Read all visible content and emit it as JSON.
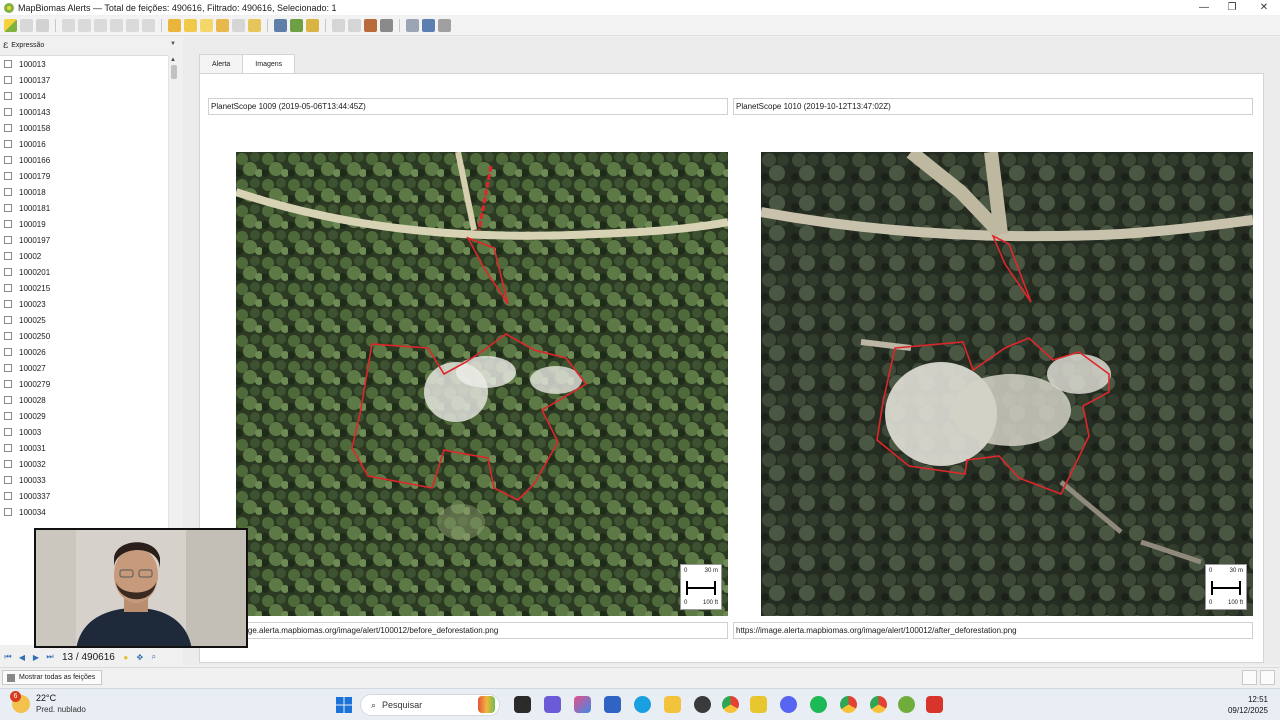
{
  "window": {
    "title": "MapBiomas Alerts — Total de feições: 490616, Filtrado: 490616, Selecionado: 1",
    "minimize_glyph": "—",
    "maximize_glyph": "❐",
    "close_glyph": "✕"
  },
  "left_panel": {
    "expression_label": "Expressão",
    "feature_ids": [
      "100013",
      "1000137",
      "100014",
      "1000143",
      "1000158",
      "100016",
      "1000166",
      "1000179",
      "100018",
      "1000181",
      "100019",
      "1000197",
      "10002",
      "1000201",
      "1000215",
      "100023",
      "100025",
      "1000250",
      "100026",
      "100027",
      "1000279",
      "100028",
      "100029",
      "10003",
      "100031",
      "100032",
      "100033",
      "1000337",
      "100034"
    ],
    "nav": {
      "position": "13",
      "separator": " / ",
      "total": "490616"
    }
  },
  "tabs": [
    {
      "label": "Alerta",
      "active": false
    },
    {
      "label": "Imagens",
      "active": true
    }
  ],
  "images": {
    "before": {
      "caption": "PlanetScope 1009 (2019-05-06T13:44:45Z)",
      "url": "https://image.alerta.mapbiomas.org/image/alert/100012/before_deforestation.png",
      "scale": {
        "top_left": "0",
        "top_right": "30 m",
        "bottom_left": "0",
        "bottom_right": "100 ft"
      }
    },
    "after": {
      "caption": "PlanetScope 1010 (2019-10-12T13:47:02Z)",
      "url": "https://image.alerta.mapbiomas.org/image/alert/100012/after_deforestation.png",
      "scale": {
        "top_left": "0",
        "top_right": "30 m",
        "bottom_left": "0",
        "bottom_right": "100 ft"
      }
    }
  },
  "status_bar": {
    "show_all_label": "Mostrar todas as feições"
  },
  "taskbar": {
    "weather_badge": "6",
    "temperature": "22°C",
    "condition": "Pred. nublado",
    "search_placeholder": "Pesquisar",
    "time": "12:51",
    "date": "09/12/2025"
  },
  "colors": {
    "polygon": "#e0262b",
    "accent": "#2f6fb3"
  }
}
